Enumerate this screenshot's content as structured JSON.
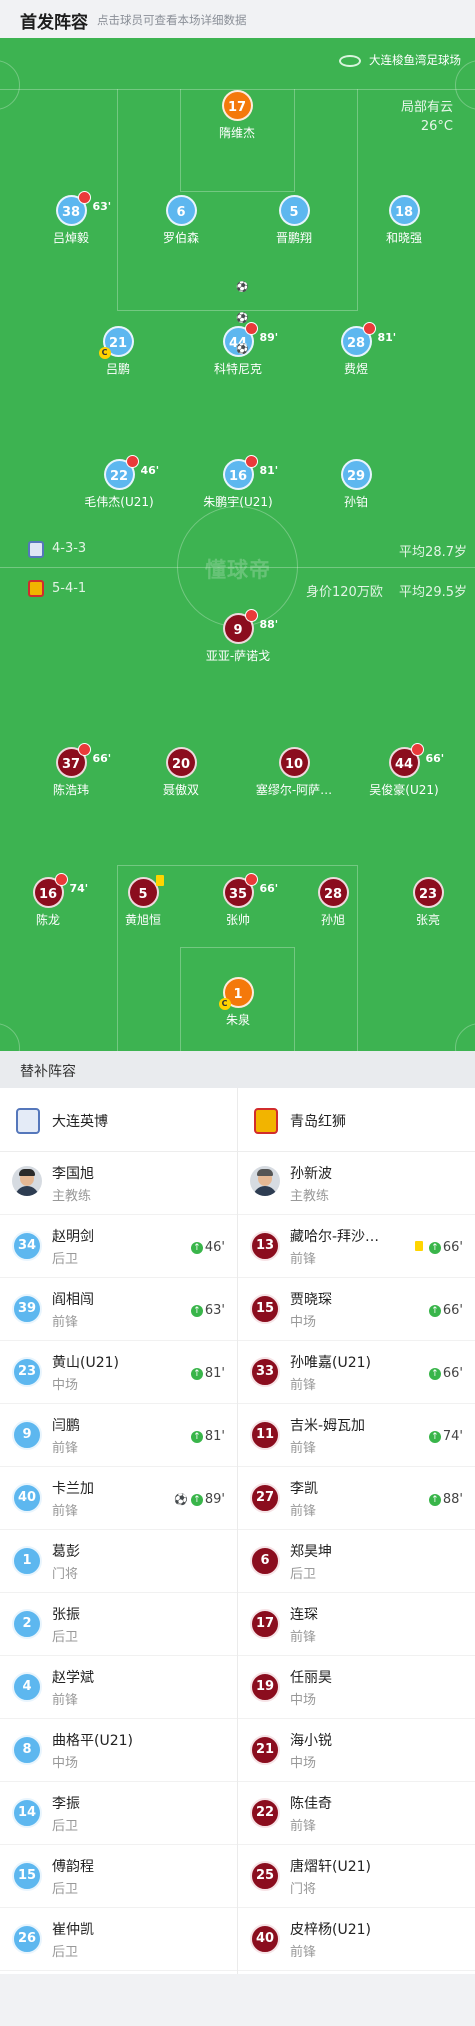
{
  "header": {
    "title": "首发阵容",
    "hint": "点击球员可查看本场详细数据"
  },
  "pitch": {
    "stadium": "大连梭鱼湾足球场",
    "weather": "局部有云",
    "temperature": "26°C",
    "watermark": "懂球帝",
    "home": {
      "formation": "4-3-3",
      "avg_age": "平均28.7岁",
      "color": "#5db7ef"
    },
    "away": {
      "formation": "5-4-1",
      "value": "身价120万欧",
      "avg_age": "平均29.5岁",
      "color": "#8b0d1e"
    }
  },
  "starters": [
    {
      "num": "17",
      "name": "隋维杰"
    },
    {
      "num": "38",
      "name": "吕焯毅",
      "sub": "63'"
    },
    {
      "num": "6",
      "name": "罗伯森"
    },
    {
      "num": "5",
      "name": "晋鹏翔"
    },
    {
      "num": "18",
      "name": "和晓强"
    },
    {
      "num": "21",
      "name": "吕鹏"
    },
    {
      "num": "44",
      "name": "科特尼克",
      "sub": "89'",
      "goals": "⚽⚽⚽"
    },
    {
      "num": "28",
      "name": "费煜",
      "sub": "81'"
    },
    {
      "num": "22",
      "name": "毛伟杰(U21)",
      "sub": "46'"
    },
    {
      "num": "16",
      "name": "朱鹏宇(U21)",
      "sub": "81'"
    },
    {
      "num": "29",
      "name": "孙铂"
    },
    {
      "num": "9",
      "name": "亚亚-萨诺戈",
      "sub": "88'"
    },
    {
      "num": "37",
      "name": "陈浩玮",
      "sub": "66'"
    },
    {
      "num": "20",
      "name": "聂傲双"
    },
    {
      "num": "10",
      "name": "塞缪尔-阿萨…"
    },
    {
      "num": "44",
      "name": "吴俊豪(U21)",
      "sub": "66'"
    },
    {
      "num": "16",
      "name": "陈龙",
      "sub": "74'"
    },
    {
      "num": "5",
      "name": "黄旭恒"
    },
    {
      "num": "35",
      "name": "张帅",
      "sub": "66'"
    },
    {
      "num": "28",
      "name": "孙旭"
    },
    {
      "num": "23",
      "name": "张亮"
    },
    {
      "num": "1",
      "name": "朱泉"
    }
  ],
  "subs_section": {
    "title": "替补阵容"
  },
  "home_team": {
    "name": "大连英博",
    "coach": {
      "name": "李国旭",
      "role": "主教练"
    },
    "subs": [
      {
        "num": "34",
        "name": "赵明剑",
        "pos": "后卫",
        "sub": "46'"
      },
      {
        "num": "39",
        "name": "阎相闯",
        "pos": "前锋",
        "sub": "63'"
      },
      {
        "num": "23",
        "name": "黄山(U21)",
        "pos": "中场",
        "sub": "81'"
      },
      {
        "num": "9",
        "name": "闫鹏",
        "pos": "前锋",
        "sub": "81'"
      },
      {
        "num": "40",
        "name": "卡兰加",
        "pos": "前锋",
        "sub": "89'",
        "goal": "⚽"
      },
      {
        "num": "1",
        "name": "葛彭",
        "pos": "门将"
      },
      {
        "num": "2",
        "name": "张振",
        "pos": "后卫"
      },
      {
        "num": "4",
        "name": "赵学斌",
        "pos": "前锋"
      },
      {
        "num": "8",
        "name": "曲格平(U21)",
        "pos": "中场"
      },
      {
        "num": "14",
        "name": "李振",
        "pos": "后卫"
      },
      {
        "num": "15",
        "name": "傅韵程",
        "pos": "后卫"
      },
      {
        "num": "26",
        "name": "崔仲凯",
        "pos": "后卫"
      }
    ]
  },
  "away_team": {
    "name": "青岛红狮",
    "coach": {
      "name": "孙新波",
      "role": "主教练"
    },
    "subs": [
      {
        "num": "13",
        "name": "藏哈尔-拜沙…",
        "pos": "前锋",
        "sub": "66'"
      },
      {
        "num": "15",
        "name": "贾晓琛",
        "pos": "中场",
        "sub": "66'"
      },
      {
        "num": "33",
        "name": "孙唯嘉(U21)",
        "pos": "前锋",
        "sub": "66'"
      },
      {
        "num": "11",
        "name": "吉米-姆瓦加",
        "pos": "前锋",
        "sub": "74'"
      },
      {
        "num": "27",
        "name": "李凯",
        "pos": "前锋",
        "sub": "88'"
      },
      {
        "num": "6",
        "name": "郑昊坤",
        "pos": "后卫"
      },
      {
        "num": "17",
        "name": "连琛",
        "pos": "前锋"
      },
      {
        "num": "19",
        "name": "任丽昊",
        "pos": "中场"
      },
      {
        "num": "21",
        "name": "海小锐",
        "pos": "中场"
      },
      {
        "num": "22",
        "name": "陈佳奇",
        "pos": "前锋"
      },
      {
        "num": "25",
        "name": "唐熠轩(U21)",
        "pos": "门将"
      },
      {
        "num": "40",
        "name": "皮梓杨(U21)",
        "pos": "前锋"
      }
    ]
  }
}
